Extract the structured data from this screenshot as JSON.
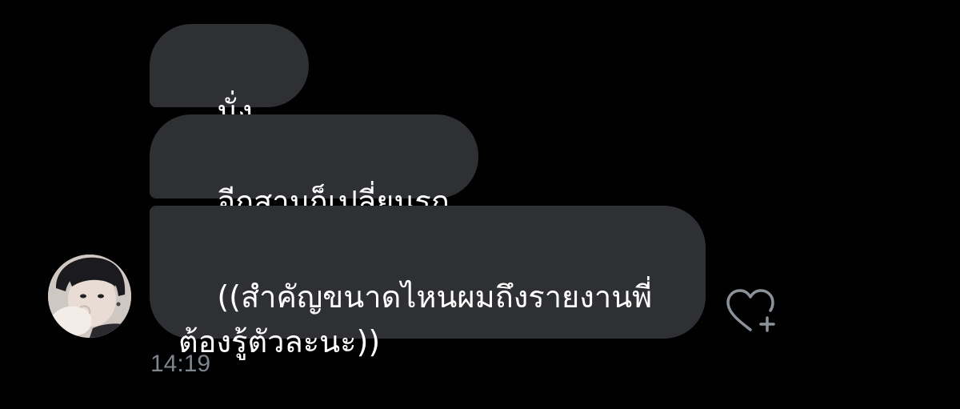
{
  "conversation": {
    "messages": [
      {
        "text": "นั่งแล้ว"
      },
      {
        "text": "อีกสามก็เปลี่ยนรถ"
      },
      {
        "text": "((สำคัญขนาดไหนผมถึงรายงานพี่\nต้องรู้ตัวละนะ))"
      }
    ],
    "timestamp": "14:19"
  },
  "colors": {
    "background": "#000000",
    "bubble": "#2f3033",
    "timestamp": "#7e858c",
    "heart_icon": "#8b9299"
  },
  "icons": {
    "react": "heart-plus-icon",
    "sender": "avatar"
  }
}
